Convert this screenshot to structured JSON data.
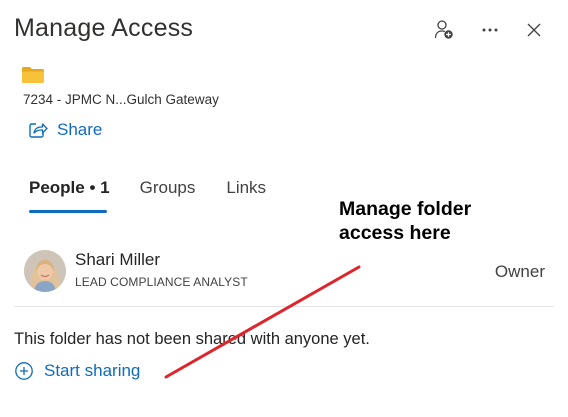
{
  "header": {
    "title": "Manage Access"
  },
  "item": {
    "name": "7234 - JPMC N...Gulch Gateway",
    "icon": "folder-icon"
  },
  "share": {
    "label": "Share",
    "icon": "share-icon"
  },
  "tabs": [
    {
      "label": "People",
      "count": "1",
      "selected": true
    },
    {
      "label": "Groups",
      "selected": false
    },
    {
      "label": "Links",
      "selected": false
    }
  ],
  "annotation": {
    "text": "Manage folder\naccess here",
    "line_color": "#e0242b"
  },
  "people": [
    {
      "name": "Shari Miller",
      "title": "LEAD COMPLIANCE ANALYST",
      "role": "Owner"
    }
  ],
  "empty_state": {
    "message": "This folder has not been shared with anyone yet.",
    "start_sharing_label": "Start sharing"
  },
  "colors": {
    "accent": "#0f6cbd",
    "folder": "#f7c23a",
    "annotation_line": "#e0242b"
  }
}
